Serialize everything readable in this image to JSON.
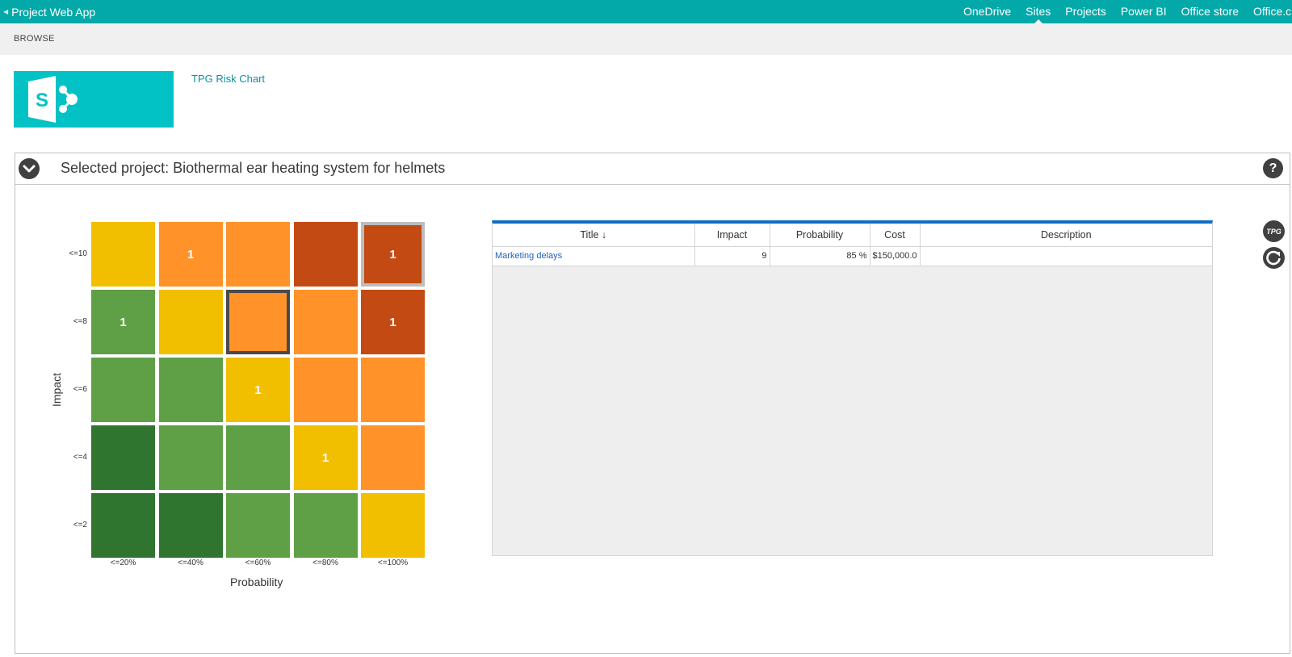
{
  "suite_bar": {
    "app_name": "Project Web App",
    "nav": [
      "OneDrive",
      "Sites",
      "Projects",
      "Power BI",
      "Office store",
      "Office.c"
    ],
    "active": "Sites"
  },
  "ribbon": {
    "tab": "BROWSE"
  },
  "site": {
    "title": "TPG Risk Chart"
  },
  "webpart": {
    "title": "Selected project: Biothermal ear heating system for helmets",
    "help": "?"
  },
  "matrix": {
    "y_axis_title": "Impact",
    "x_axis_title": "Probability",
    "y_labels": [
      "<=10",
      "<=8",
      "<=6",
      "<=4",
      "<=2"
    ],
    "x_labels": [
      "<=20%",
      "<=40%",
      "<=60%",
      "<=80%",
      "<=100%"
    ],
    "colors": {
      "darkgreen": "#2f7530",
      "green": "#5fa046",
      "yellow": "#f2be00",
      "orange": "#ff9229",
      "red": "#c44a13"
    },
    "rows": [
      [
        {
          "c": "yellow",
          "n": ""
        },
        {
          "c": "orange",
          "n": "1"
        },
        {
          "c": "orange",
          "n": ""
        },
        {
          "c": "red",
          "n": ""
        },
        {
          "c": "red",
          "n": "1",
          "sel": "light"
        }
      ],
      [
        {
          "c": "green",
          "n": "1"
        },
        {
          "c": "yellow",
          "n": ""
        },
        {
          "c": "orange",
          "n": "",
          "sel": "dark"
        },
        {
          "c": "orange",
          "n": ""
        },
        {
          "c": "red",
          "n": "1"
        }
      ],
      [
        {
          "c": "green",
          "n": ""
        },
        {
          "c": "green",
          "n": ""
        },
        {
          "c": "yellow",
          "n": "1"
        },
        {
          "c": "orange",
          "n": ""
        },
        {
          "c": "orange",
          "n": ""
        }
      ],
      [
        {
          "c": "darkgreen",
          "n": ""
        },
        {
          "c": "green",
          "n": ""
        },
        {
          "c": "green",
          "n": ""
        },
        {
          "c": "yellow",
          "n": "1"
        },
        {
          "c": "orange",
          "n": ""
        }
      ],
      [
        {
          "c": "darkgreen",
          "n": ""
        },
        {
          "c": "darkgreen",
          "n": ""
        },
        {
          "c": "green",
          "n": ""
        },
        {
          "c": "green",
          "n": ""
        },
        {
          "c": "yellow",
          "n": ""
        }
      ]
    ]
  },
  "table": {
    "columns": [
      "Title ↓",
      "Impact",
      "Probability",
      "Cost",
      "Description"
    ],
    "rows": [
      {
        "title": "Marketing delays",
        "impact": "9",
        "probability": "85 %",
        "cost": "$150,000.0",
        "description": ""
      }
    ]
  },
  "side_icons": {
    "logo_text": "TPG"
  }
}
